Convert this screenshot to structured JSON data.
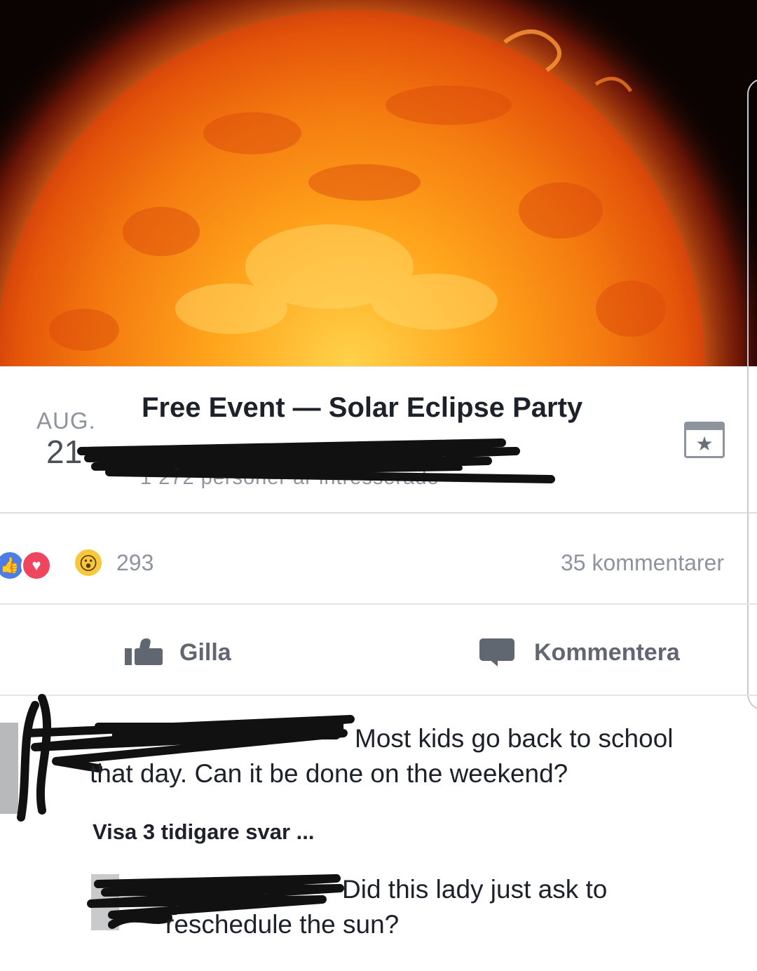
{
  "event": {
    "month": "AUG.",
    "day": "21",
    "title": "Free Event — Solar Eclipse Party",
    "interested": "1 272 personer är intresserade"
  },
  "icons": {
    "calendar": "calendar-star-icon",
    "like_reaction": "like-reaction-icon",
    "love_reaction": "love-reaction-icon",
    "wow_reaction": "wow-reaction-icon",
    "like_action": "thumbs-up-icon",
    "comment_action": "comment-bubble-icon"
  },
  "colors": {
    "like_blue": "#4a7ee6",
    "love_red": "#f0455e",
    "wow_yellow": "#f7c83c",
    "muted_text": "#8d949e",
    "action_text": "#606770"
  },
  "reactions": {
    "count": "293",
    "comments": "35 kommentarer"
  },
  "actions": {
    "like_label": "Gilla",
    "comment_label": "Kommentera"
  },
  "comments": [
    {
      "text_line1": "Most kids go back to school",
      "text_line2": "that day. Can it be done on the weekend?"
    },
    {
      "view_replies": "Visa 3 tidigare svar ...",
      "text_line1": "Did this lady just ask to",
      "text_line2": "reschedule the sun?"
    }
  ]
}
